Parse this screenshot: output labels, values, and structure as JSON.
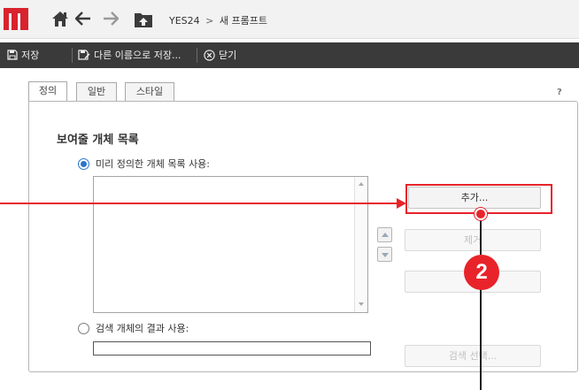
{
  "breadcrumb": {
    "root": "YES24",
    "separator": ">",
    "current": "새 프롬프트"
  },
  "toolbar": {
    "save_label": "저장",
    "save_as_label": "다른 이름으로 저장...",
    "close_label": "닫기"
  },
  "tabs": [
    {
      "label": "정의",
      "active": true
    },
    {
      "label": "일반",
      "active": false
    },
    {
      "label": "스타일",
      "active": false
    }
  ],
  "help_label": "?",
  "section_title": "보여줄 개체 목록",
  "option_predefined": {
    "label": "미리 정의한 개체 목록 사용:",
    "selected": true
  },
  "option_search": {
    "label": "검색 개체의 결과 사용:",
    "selected": false
  },
  "buttons": {
    "add_label": "추가...",
    "remove_label": "제거",
    "third_label": "",
    "search_select_label": "검색 선택..."
  },
  "annotation": {
    "step_number": "2",
    "color": "#e8232a"
  },
  "colors": {
    "brand": "#d9232e",
    "toolbar_bg": "#3a3a3a",
    "radio_selected": "#2a74c9"
  },
  "icons": [
    "logo-m-icon",
    "home-icon",
    "back-arrow-icon",
    "forward-arrow-icon",
    "folder-up-icon",
    "save-icon",
    "save-as-icon",
    "close-circle-icon"
  ]
}
